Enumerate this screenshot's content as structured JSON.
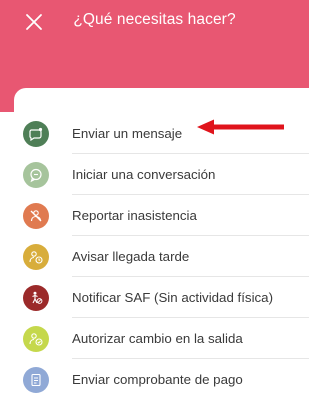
{
  "header": {
    "title": "¿Qué necesitas hacer?",
    "color": "#e85772",
    "close_icon": "close-icon"
  },
  "menu": {
    "items": [
      {
        "label": "Enviar un mensaje",
        "icon": "message-icon",
        "color": "#4f7f57"
      },
      {
        "label": "Iniciar una conversación",
        "icon": "chat-icon",
        "color": "#a6c49c"
      },
      {
        "label": "Reportar inasistencia",
        "icon": "no-attendance-icon",
        "color": "#e07a50"
      },
      {
        "label": "Avisar llegada tarde",
        "icon": "late-arrival-icon",
        "color": "#d8ad3b"
      },
      {
        "label": "Notificar SAF (Sin actividad física)",
        "icon": "no-activity-icon",
        "color": "#9b2a2a"
      },
      {
        "label": "Autorizar cambio en la salida",
        "icon": "exit-change-icon",
        "color": "#c5d84c"
      },
      {
        "label": "Enviar comprobante de pago",
        "icon": "receipt-icon",
        "color": "#90a9d6"
      }
    ]
  },
  "annotation": {
    "arrow_color": "#e0141c",
    "arrow_icon": "arrow-left-icon"
  }
}
